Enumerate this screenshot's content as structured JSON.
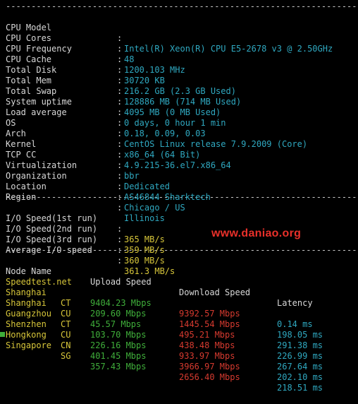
{
  "divider": "----------------------------------------------------------------------",
  "system_info": [
    {
      "label": "CPU Model",
      "sep": ":",
      "value": "Intel(R) Xeon(R) CPU E5-2678 v3 @ 2.50GHz"
    },
    {
      "label": "CPU Cores",
      "sep": ":",
      "value": "48"
    },
    {
      "label": "CPU Frequency",
      "sep": ":",
      "value": "1200.103 MHz"
    },
    {
      "label": "CPU Cache",
      "sep": ":",
      "value": "30720 KB"
    },
    {
      "label": "Total Disk",
      "sep": ":",
      "value": "216.2 GB (2.3 GB Used)"
    },
    {
      "label": "Total Mem",
      "sep": ":",
      "value": "128886 MB (714 MB Used)"
    },
    {
      "label": "Total Swap",
      "sep": ":",
      "value": "4095 MB (0 MB Used)"
    },
    {
      "label": "System uptime",
      "sep": ":",
      "value": "0 days, 0 hour 1 min"
    },
    {
      "label": "Load average",
      "sep": ":",
      "value": "0.18, 0.09, 0.03"
    },
    {
      "label": "OS",
      "sep": ":",
      "value": "CentOS Linux release 7.9.2009 (Core)"
    },
    {
      "label": "Arch",
      "sep": ":",
      "value": "x86_64 (64 Bit)"
    },
    {
      "label": "Kernel",
      "sep": ":",
      "value": "4.9.215-36.el7.x86_64"
    },
    {
      "label": "TCP CC",
      "sep": ":",
      "value": "bbr"
    },
    {
      "label": "Virtualization",
      "sep": ":",
      "value": "Dedicated"
    },
    {
      "label": "Organization",
      "sep": ":",
      "value": "AS46844 Sharktech"
    },
    {
      "label": "Location",
      "sep": ":",
      "value": "Chicago / US"
    },
    {
      "label": "Region",
      "sep": ":",
      "value": "Illinois"
    }
  ],
  "io_tests": [
    {
      "label": "I/O Speed(1st run)",
      "sep": ":",
      "value": "365 MB/s"
    },
    {
      "label": "I/O Speed(2nd run)",
      "sep": ":",
      "value": "359 MB/s"
    },
    {
      "label": "I/O Speed(3rd run)",
      "sep": ":",
      "value": "360 MB/s"
    },
    {
      "label": "Average I/O speed",
      "sep": ":",
      "value": "361.3 MB/s"
    }
  ],
  "watermark": "www.daniao.org",
  "speedtest": {
    "headers": {
      "node": "Node Name",
      "upload": "Upload Speed",
      "download": "Download Speed",
      "latency": "Latency"
    },
    "rows": [
      {
        "node": "Speedtest.net",
        "isp": "",
        "upload": "9404.23 Mbps",
        "download": "9392.57 Mbps",
        "latency": "0.14 ms"
      },
      {
        "node": "Shanghai",
        "isp": "CT",
        "upload": "209.60 Mbps",
        "download": "1445.54 Mbps",
        "latency": "198.05 ms"
      },
      {
        "node": "Shanghai",
        "isp": "CU",
        "upload": "45.57 Mbps",
        "download": "495.21 Mbps",
        "latency": "291.38 ms"
      },
      {
        "node": "Guangzhou",
        "isp": "CT",
        "upload": "103.70 Mbps",
        "download": "438.48 Mbps",
        "latency": "226.99 ms"
      },
      {
        "node": "Shenzhen",
        "isp": "CU",
        "upload": "226.16 Mbps",
        "download": "933.97 Mbps",
        "latency": "267.64 ms"
      },
      {
        "node": "Hongkong",
        "isp": "CN",
        "upload": "401.45 Mbps",
        "download": "3966.97 Mbps",
        "latency": "202.10 ms"
      },
      {
        "node": "Singapore",
        "isp": "SG",
        "upload": "357.43 Mbps",
        "download": "2656.40 Mbps",
        "latency": "218.51 ms"
      }
    ]
  },
  "colors": {
    "background": "#000000",
    "label": "#d8d8d8",
    "value_cyan": "#2fa8c0",
    "value_yellow": "#d7c63a",
    "upload_green": "#3fae3a",
    "download_red": "#d63a2f",
    "watermark_red": "#e8302a"
  }
}
